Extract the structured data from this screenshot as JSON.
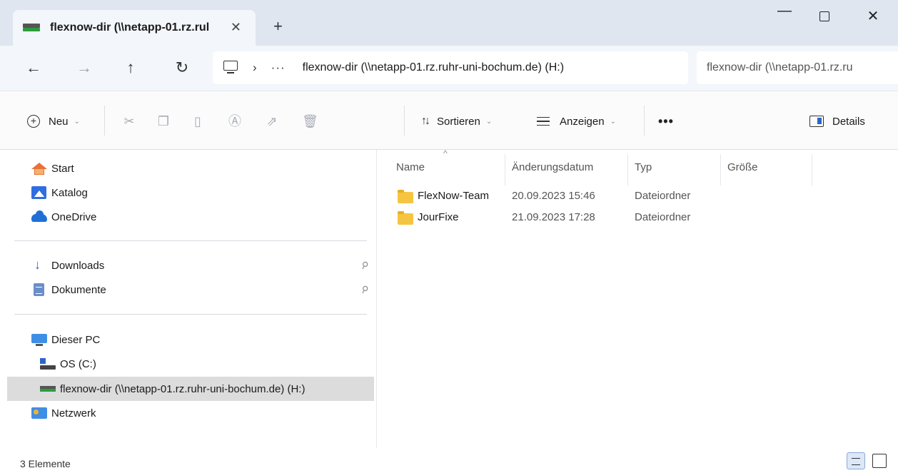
{
  "window": {
    "tab_title": "flexnow-dir (\\\\netapp-01.rz.rul",
    "tab_close": "✕",
    "new_tab": "+",
    "minimize": "—",
    "close": "✕"
  },
  "address": {
    "back": "←",
    "forward": "→",
    "up": "↑",
    "refresh": "↻",
    "chevron": "›",
    "more": "···",
    "path": "flexnow-dir (\\\\netapp-01.rz.ruhr-uni-bochum.de) (H:)",
    "search_text": "flexnow-dir (\\\\netapp-01.rz.ru"
  },
  "toolbar": {
    "new_label": "Neu",
    "sort_label": "Sortieren",
    "view_label": "Anzeigen",
    "more_label": "•••",
    "details_label": "Details",
    "chevron": "⌄"
  },
  "nav": {
    "home": "Start",
    "gallery": "Katalog",
    "onedrive": "OneDrive",
    "downloads": "Downloads",
    "documents": "Dokumente",
    "this_pc": "Dieser PC",
    "os_drive": "OS (C:)",
    "net_drive": "flexnow-dir (\\\\netapp-01.rz.ruhr-uni-bochum.de) (H:)",
    "network": "Netzwerk",
    "pin": "📌"
  },
  "columns": {
    "name": "Name",
    "modified": "Änderungsdatum",
    "type": "Typ",
    "size": "Größe",
    "sort_caret": "^"
  },
  "files": [
    {
      "name": "FlexNow-Team",
      "modified": "20.09.2023 15:46",
      "type": "Dateiordner"
    },
    {
      "name": "JourFixe",
      "modified": "21.09.2023 17:28",
      "type": "Dateiordner"
    }
  ],
  "status": {
    "count": "3 Elemente"
  }
}
